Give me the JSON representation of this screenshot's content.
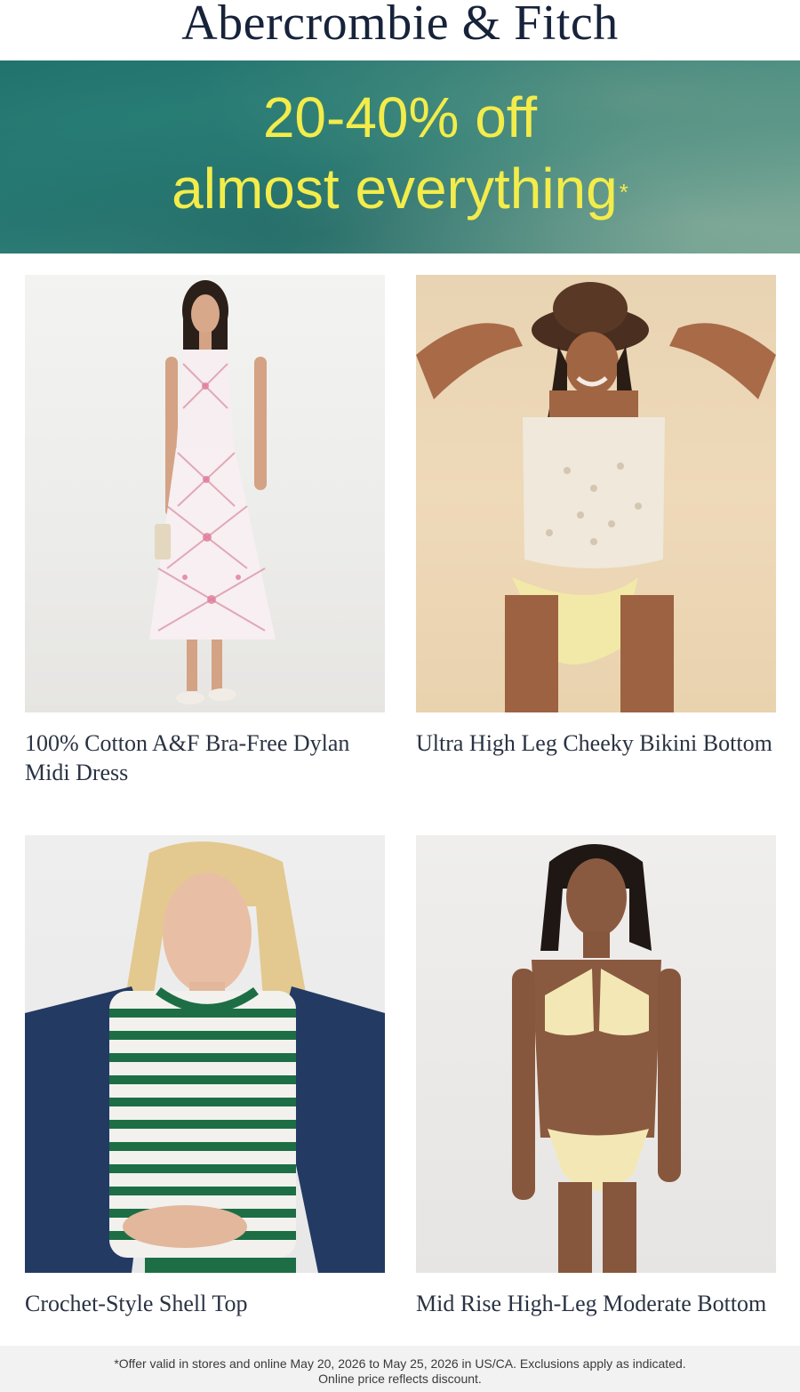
{
  "brand": {
    "name": "Abercrombie & Fitch"
  },
  "banner": {
    "line1": "20-40% off",
    "line2": "almost everything",
    "asterisk": "*",
    "text_color": "#f3ec4a",
    "bg_color": "#2a7a74"
  },
  "products": [
    {
      "title": "100% Cotton A&F Bra-Free Dylan Midi Dress",
      "image": "model-in-floral-midi-dress"
    },
    {
      "title": "Ultra High Leg Cheeky Bikini Bottom",
      "image": "model-in-eyelet-top-and-bikini-bottom"
    },
    {
      "title": "Crochet-Style Shell Top",
      "image": "model-in-striped-crochet-top-and-denim-jacket"
    },
    {
      "title": "Mid Rise High-Leg Moderate Bottom",
      "image": "model-in-yellow-ribbed-bikini"
    }
  ],
  "footer": {
    "line1": "*Offer valid in stores and online May 20, 2026 to May 25, 2026 in US/CA. Exclusions apply as indicated.",
    "line2": "Online price reflects discount."
  }
}
